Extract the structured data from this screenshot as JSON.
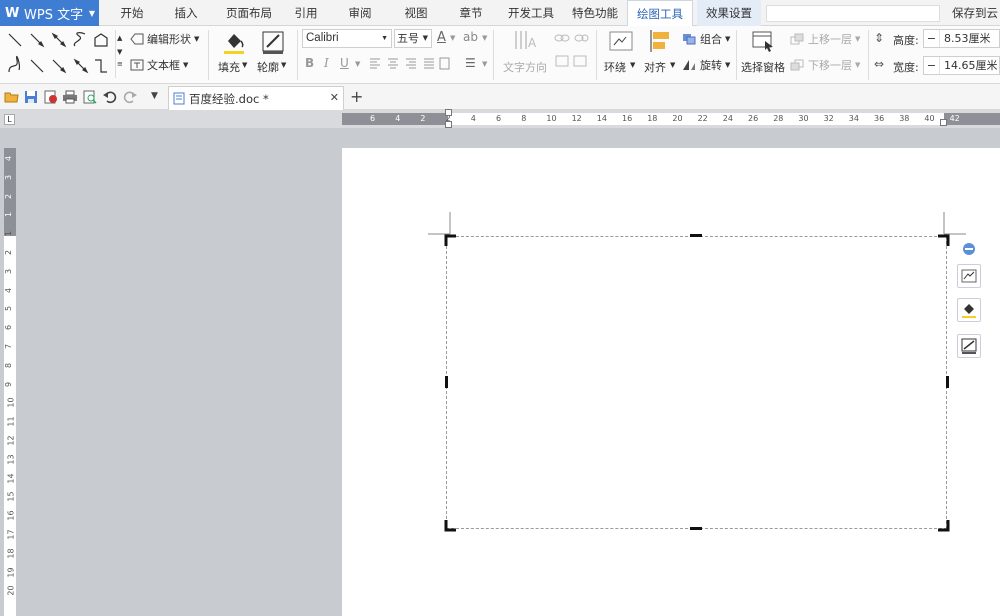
{
  "app": {
    "name": "WPS 文字",
    "logo_glyph": "W"
  },
  "menu": {
    "tabs": [
      "开始",
      "插入",
      "页面布局",
      "引用",
      "审阅",
      "视图",
      "章节",
      "开发工具",
      "特色功能",
      "绘图工具",
      "效果设置"
    ],
    "active_tab": "绘图工具",
    "save_cloud": "保存到云"
  },
  "ribbon": {
    "edit_shape": "编辑形状",
    "textbox": "文本框",
    "fill": "填充",
    "outline": "轮廓",
    "font_name": "Calibri",
    "font_size": "五号",
    "text_direction": "文字方向",
    "wrap": "环绕",
    "align": "对齐",
    "group": "组合",
    "rotate": "旋转",
    "selection_pane": "选择窗格",
    "bring_forward": "上移一层",
    "send_backward": "下移一层",
    "height_label": "高度:",
    "height_value": "8.53厘米",
    "width_label": "宽度:",
    "width_value": "14.65厘米"
  },
  "document": {
    "tab_name": "百度经验.doc *"
  },
  "ruler": {
    "h_numbers": [
      "6",
      "4",
      "2",
      "2",
      "4",
      "6",
      "8",
      "10",
      "12",
      "14",
      "16",
      "18",
      "20",
      "22",
      "24",
      "26",
      "28",
      "30",
      "32",
      "34",
      "36",
      "38",
      "40",
      "42"
    ],
    "v_numbers": [
      "4",
      "3",
      "2",
      "1",
      "1",
      "2",
      "3",
      "4",
      "5",
      "6",
      "7",
      "8",
      "9",
      "10",
      "11",
      "12",
      "13",
      "14",
      "15",
      "16",
      "17",
      "18",
      "19",
      "20"
    ]
  },
  "colors": {
    "accent": "#3f7dd2",
    "active_tab_text": "#2b62b6",
    "fill_yellow": "#f2d321",
    "workspace": "#c8cbd0"
  }
}
